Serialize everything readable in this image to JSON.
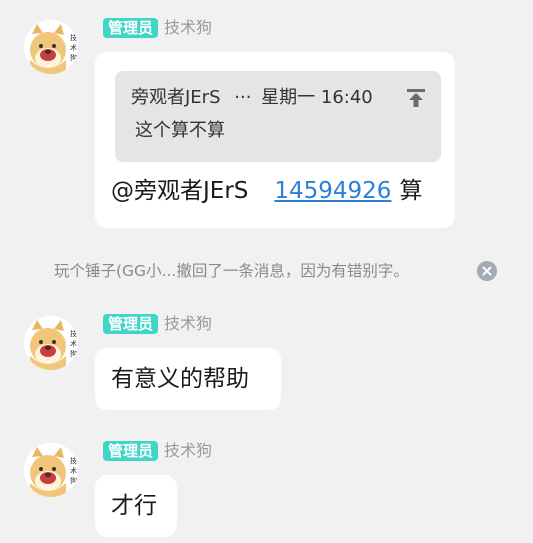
{
  "messages": [
    {
      "role_badge": "管理员",
      "sender": "技术狗",
      "quote": {
        "author": "旁观者JErS",
        "separator": "···",
        "time": "星期一 16:40",
        "text": "这个算不算"
      },
      "mention": "@旁观者JErS",
      "link_text": "14594926",
      "trailing_text": "算"
    },
    {
      "role_badge": "管理员",
      "sender": "技术狗",
      "text": "有意义的帮助"
    },
    {
      "role_badge": "管理员",
      "sender": "技术狗",
      "text": "才行"
    }
  ],
  "system_notice": {
    "text": "玩个锤子(GG小...撤回了一条消息，因为有错别字。"
  },
  "icons": {
    "avatar": "shiba-dog-avatar-icon",
    "pin": "pin-top-icon",
    "close": "close-circle-icon"
  },
  "colors": {
    "background": "#f1f1f1",
    "badge": "#3fd6c8",
    "link": "#2d7fd6",
    "quote_bg": "#e5e5e5"
  }
}
